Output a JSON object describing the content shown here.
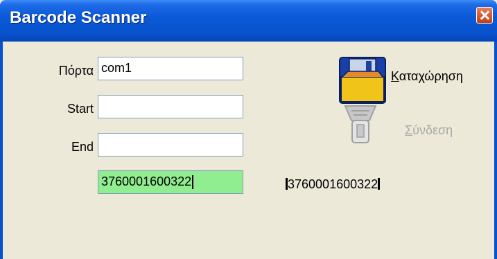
{
  "window": {
    "title": "Barcode Scanner"
  },
  "form": {
    "port": {
      "label": "Πόρτα",
      "value": "com1"
    },
    "start": {
      "label": "Start",
      "value": ""
    },
    "end": {
      "label": "End",
      "value": ""
    },
    "barcode_input": {
      "value": "3760001600322",
      "background": "#90EE90"
    }
  },
  "actions": {
    "save": {
      "first_letter": "Κ",
      "rest": "αταχώρηση",
      "icon": "floppy-disk-icon",
      "enabled": true
    },
    "connect": {
      "first_letter": "Σ",
      "rest": "ύνδεση",
      "icon": "barcode-scanner-icon",
      "enabled": false
    }
  },
  "readout": {
    "value": "3760001600322"
  },
  "colors": {
    "titlebar": "#0A5AD8",
    "window": "#ECE9D8",
    "highlight_input": "#90EE90",
    "disabled_text": "#A8A8A8"
  }
}
